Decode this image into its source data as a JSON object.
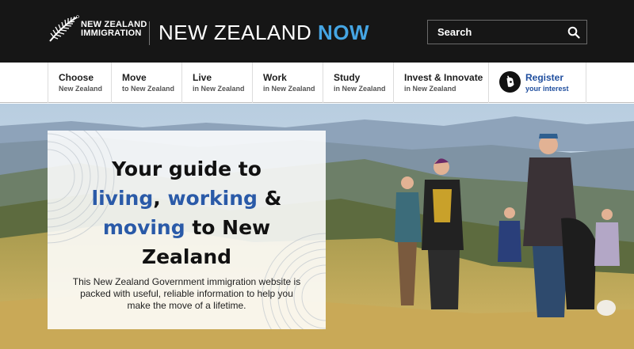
{
  "header": {
    "logo_line1": "NEW ZEALAND",
    "logo_line2": "IMMIGRATION",
    "logo_icon": "fern-icon",
    "site_title_main": "NEW ZEALAND",
    "site_title_accent": "NOW",
    "accent_color": "#45a5e3",
    "background_color": "#161616",
    "search": {
      "placeholder": "Search",
      "value": "",
      "icon": "search-icon"
    }
  },
  "nav": {
    "items": [
      {
        "title": "Choose",
        "subtitle": "New Zealand"
      },
      {
        "title": "Move",
        "subtitle": "to New Zealand"
      },
      {
        "title": "Live",
        "subtitle": "in New Zealand"
      },
      {
        "title": "Work",
        "subtitle": "in New Zealand"
      },
      {
        "title": "Study",
        "subtitle": "in New Zealand"
      },
      {
        "title": "Invest & Innovate",
        "subtitle": "in New Zealand"
      }
    ],
    "register": {
      "title": "Register",
      "subtitle": "your interest",
      "icon": "register-icon",
      "color": "#1f4e9e"
    }
  },
  "hero": {
    "headline": {
      "part1": "Your guide to",
      "hl1": "living",
      "sep1": ", ",
      "hl2": "working",
      "sep2": " &",
      "hl3": "moving",
      "part2": " to New",
      "part3": "Zealand"
    },
    "highlight_color": "#2a5aa8",
    "intro": "This New Zealand Government immigration website is packed with useful, reliable information to help you make the move of a lifetime."
  }
}
